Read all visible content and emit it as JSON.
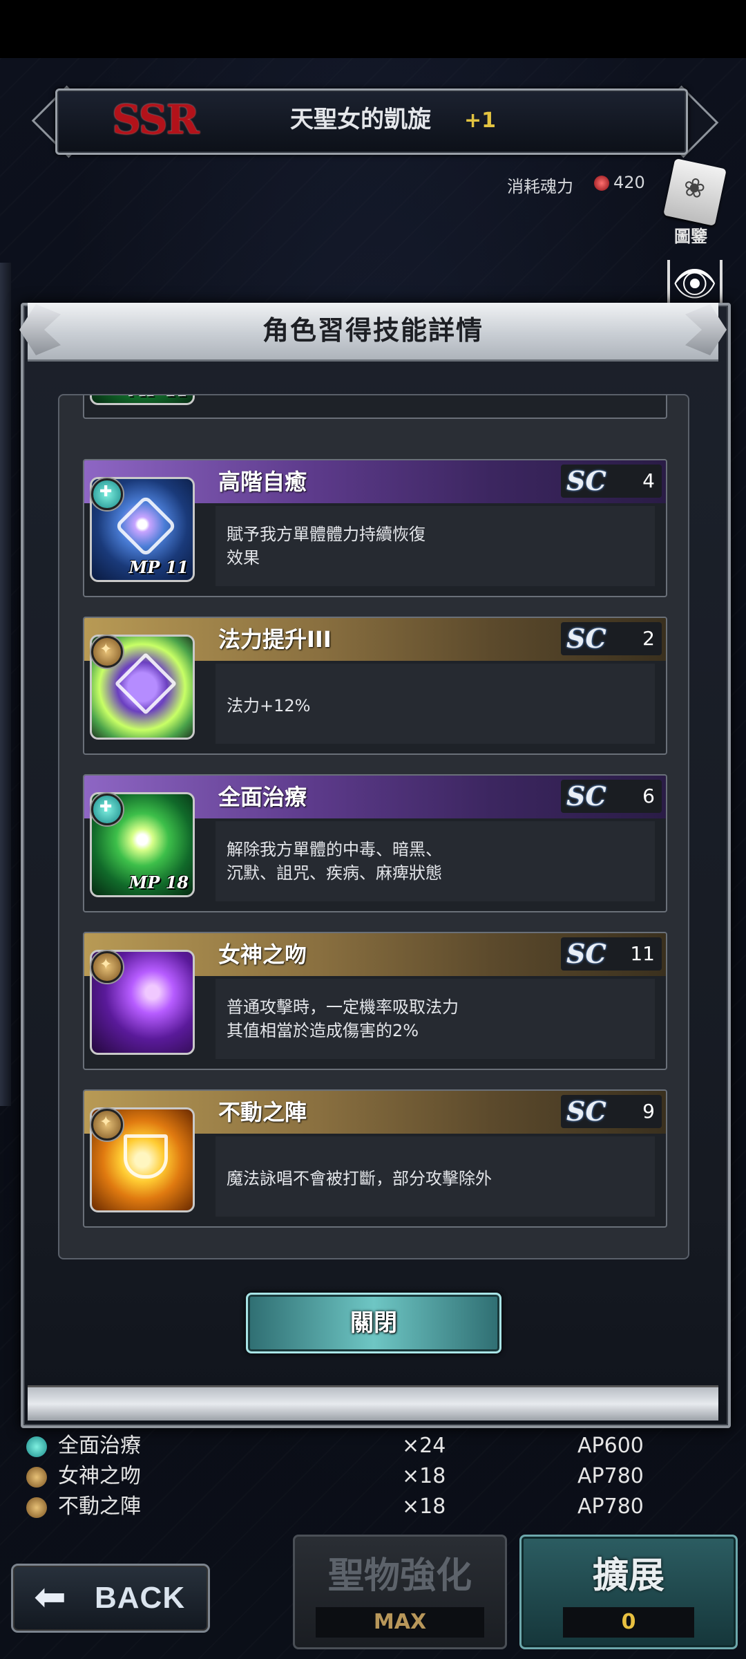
{
  "header": {
    "rarity": "SSR",
    "card_name": "天聖女的凱旋",
    "plus": "+1",
    "cost_label": "消耗魂力",
    "cost_value": "420",
    "book_label": "圖鑒"
  },
  "modal": {
    "title": "角色習得技能詳情",
    "close_label": "關閉",
    "skills": [
      {
        "name": "高階自癒",
        "type": "active",
        "sc": "4",
        "mp": "MP 11",
        "description": "賦予我方單體體力持續恢復\n效果",
        "icon": "healing-sigil-icon"
      },
      {
        "name": "法力提升III",
        "type": "passive",
        "sc": "2",
        "mp": "",
        "description": "法力+12%",
        "icon": "magic-boost-icon"
      },
      {
        "name": "全面治療",
        "type": "active",
        "sc": "6",
        "mp": "MP 18",
        "description": "解除我方單體的中毒、暗黑、\n沉默、詛咒、疾病、麻痺狀態",
        "icon": "full-cure-icon"
      },
      {
        "name": "女神之吻",
        "type": "passive",
        "sc": "11",
        "mp": "",
        "description": "普通攻擊時，一定機率吸取法力\n其值相當於造成傷害的2%",
        "icon": "goddess-kiss-icon"
      },
      {
        "name": "不動之陣",
        "type": "passive",
        "sc": "9",
        "mp": "",
        "description": "魔法詠唱不會被打斷，部分攻擊除外",
        "icon": "shield-formation-icon"
      }
    ],
    "partial_mp": "MP 11",
    "sc_label": "SC"
  },
  "bottom_list": [
    {
      "name": "全面治療",
      "count": "×24",
      "ap": "AP600",
      "type": "active"
    },
    {
      "name": "女神之吻",
      "count": "×18",
      "ap": "AP780",
      "type": "passive"
    },
    {
      "name": "不動之陣",
      "count": "×18",
      "ap": "AP780",
      "type": "passive"
    }
  ],
  "buttons": {
    "back_label": "BACK",
    "enhance_label": "聖物強化",
    "enhance_sub": "MAX",
    "expand_label": "擴展",
    "expand_sub": "0"
  }
}
